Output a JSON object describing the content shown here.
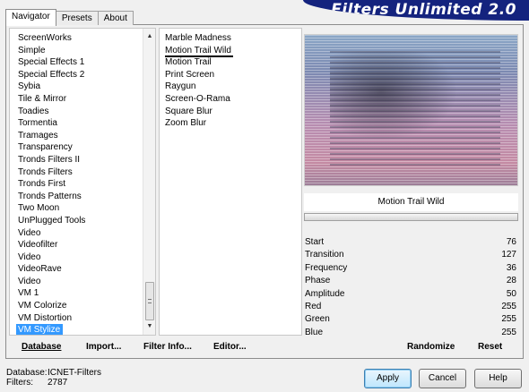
{
  "tabs": [
    "Navigator",
    "Presets",
    "About"
  ],
  "banner": {
    "title": "Filters Unlimited 2.0"
  },
  "categories": [
    "ScreenWorks",
    "Simple",
    "Special Effects 1",
    "Special Effects 2",
    "Sybia",
    "Tile & Mirror",
    "Toadies",
    "Tormentia",
    "Tramages",
    "Transparency",
    "Tronds Filters II",
    "Tronds Filters",
    "Tronds First",
    "Tronds Patterns",
    "Two Moon",
    "UnPlugged Tools",
    "Video",
    "Videofilter",
    "Video",
    "VideoRave",
    "Video",
    "VM 1",
    "VM Colorize",
    "VM Distortion",
    "VM Stylize"
  ],
  "selected_category": "VM Stylize",
  "filters": [
    "Marble Madness",
    "Motion Trail Wild",
    "Motion Trail",
    "Print Screen",
    "Raygun",
    "Screen-O-Rama",
    "Square Blur",
    "Zoom Blur"
  ],
  "selected_filter": "Motion Trail Wild",
  "preview_label": "Motion Trail Wild",
  "params": [
    {
      "name": "Start",
      "value": "76"
    },
    {
      "name": "Transition",
      "value": "127"
    },
    {
      "name": "Frequency",
      "value": "36"
    },
    {
      "name": "Phase",
      "value": "28"
    },
    {
      "name": "Amplitude",
      "value": "50"
    },
    {
      "name": "Red",
      "value": "255"
    },
    {
      "name": "Green",
      "value": "255"
    },
    {
      "name": "Blue",
      "value": "255"
    }
  ],
  "toolbar": {
    "database": "Database",
    "import": "Import...",
    "filter_info": "Filter Info...",
    "editor": "Editor...",
    "randomize": "Randomize",
    "reset": "Reset"
  },
  "footer": {
    "database_label": "Database:",
    "database_value": "ICNET-Filters",
    "filters_label": "Filters:",
    "filters_value": "2787"
  },
  "buttons": {
    "apply": "Apply",
    "cancel": "Cancel",
    "help": "Help"
  },
  "colors": {
    "banner": "#14237e",
    "selection": "#3399ff"
  }
}
